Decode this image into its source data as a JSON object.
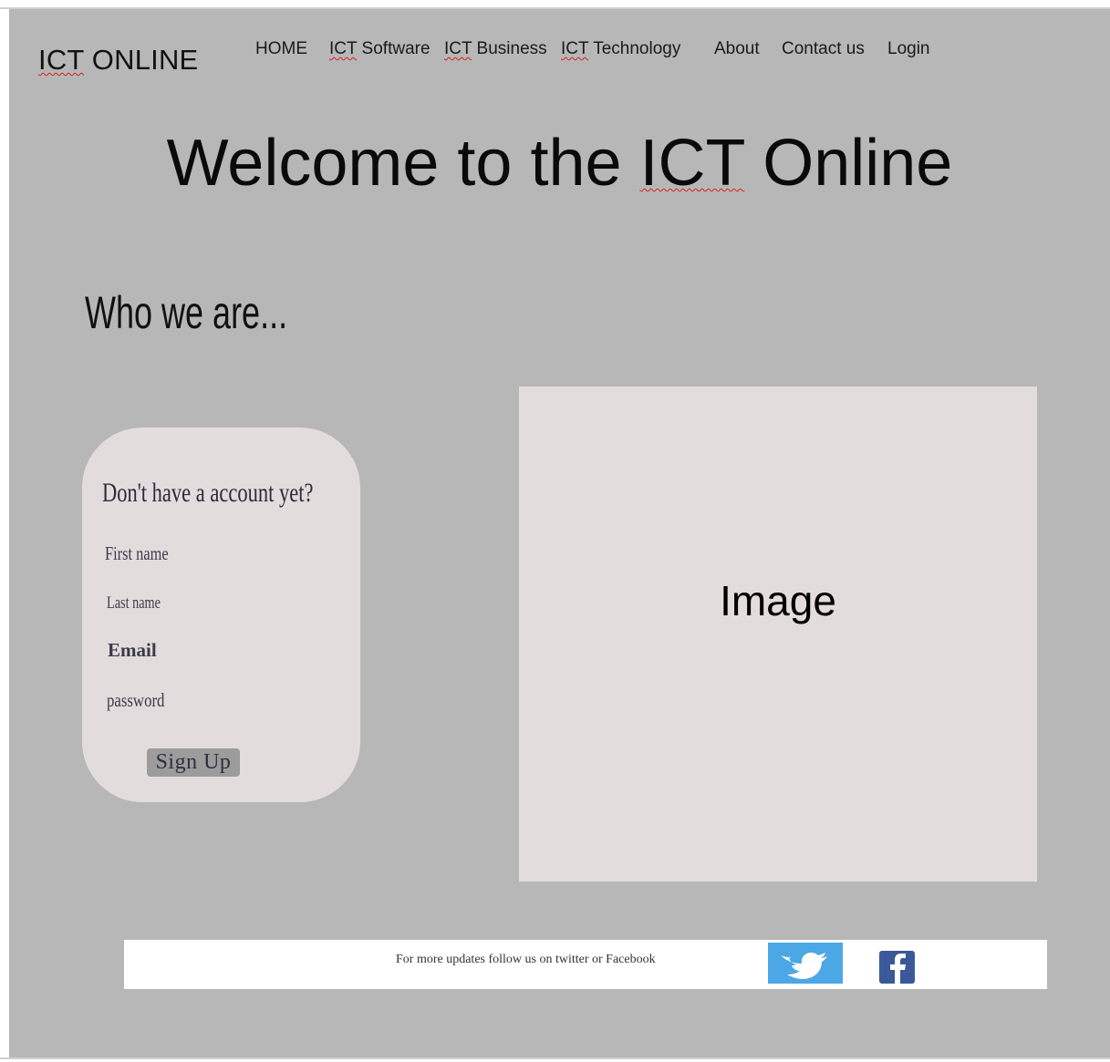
{
  "logo": {
    "prefix": "ICT",
    "suffix": " ONLINE"
  },
  "nav": {
    "items": [
      {
        "prefix": "",
        "label": "HOME"
      },
      {
        "prefix": "ICT",
        "label": " Software"
      },
      {
        "prefix": "ICT",
        "label": " Business"
      },
      {
        "prefix": "ICT",
        "label": " Technology"
      },
      {
        "prefix": "",
        "label": "About"
      },
      {
        "prefix": "",
        "label": "Contact us"
      },
      {
        "prefix": "",
        "label": "Login"
      }
    ]
  },
  "hero": {
    "before": "Welcome to the ",
    "highlight": "ICT",
    "after": " Online"
  },
  "about": {
    "heading": "Who we are..."
  },
  "signup": {
    "heading": "Don't have a account yet?",
    "fields": {
      "first_name": "First name",
      "last_name": "Last name",
      "email": "Email",
      "password": "password"
    },
    "button": "Sign Up"
  },
  "image_placeholder": {
    "label": "Image"
  },
  "footer": {
    "text": "For more updates follow us on twitter or Facebook",
    "social": [
      "twitter-icon",
      "facebook-icon"
    ]
  },
  "colors": {
    "page_background": "#b7b7b7",
    "card_background": "#e3dcdd",
    "button_background": "#9c9c9c",
    "twitter_blue": "#4ba7e5",
    "facebook_blue": "#3b5998"
  }
}
